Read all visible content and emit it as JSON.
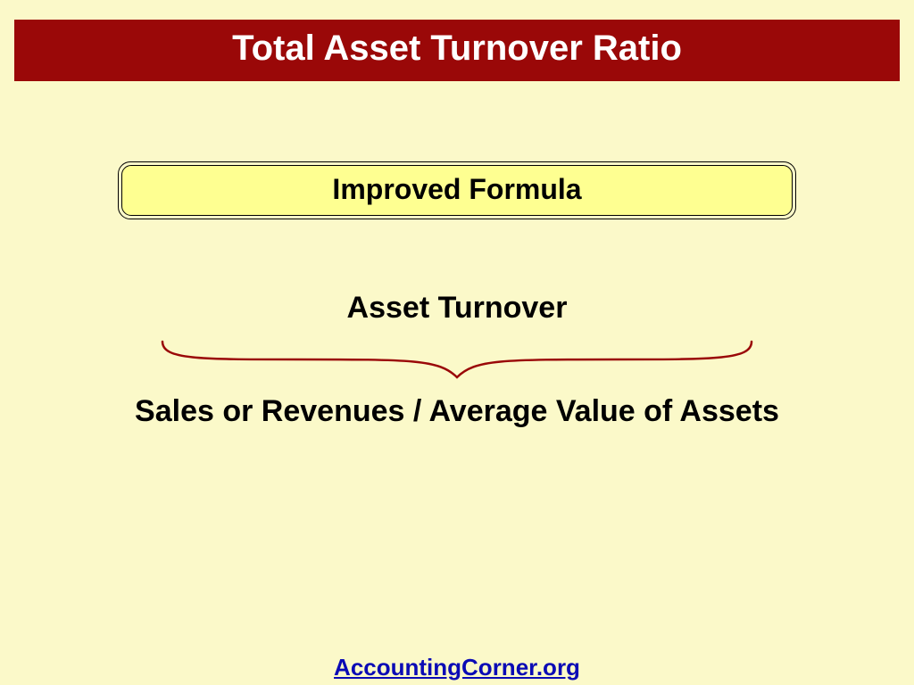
{
  "title": "Total Asset Turnover Ratio",
  "subheading": "Improved Formula",
  "formula": {
    "top": "Asset Turnover",
    "bottom": "Sales or Revenues / Average Value of Assets"
  },
  "footer": {
    "text": "AccountingCorner.org",
    "href": "#"
  },
  "colors": {
    "background": "#fbf9c9",
    "title_bar": "#9a0808",
    "subheading_fill": "#feff91",
    "brace": "#9a0808",
    "link": "#0b0bb5"
  }
}
